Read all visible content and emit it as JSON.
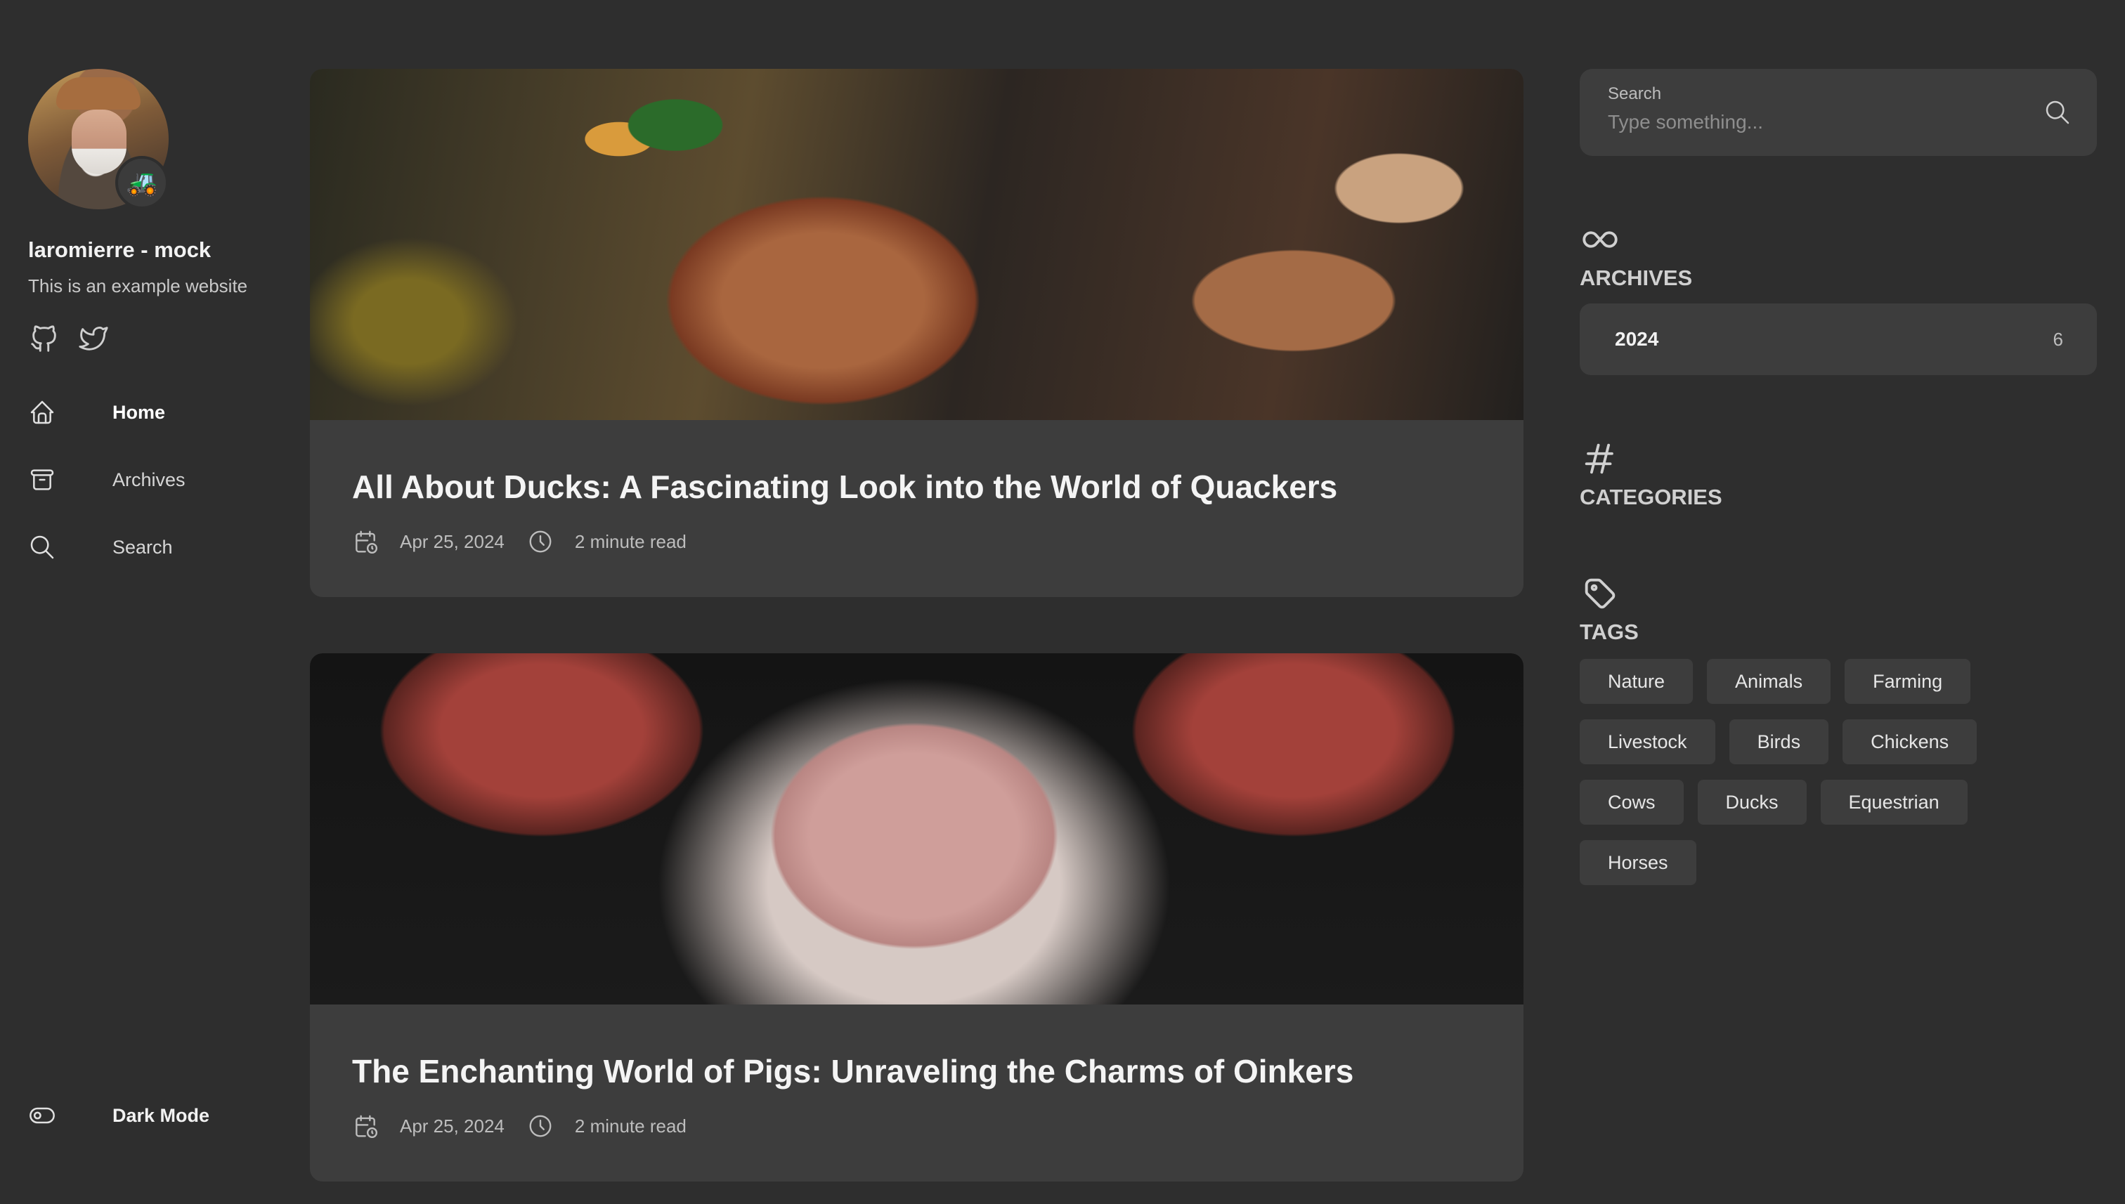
{
  "site": {
    "title": "laromierre - mock",
    "description": "This is an example website",
    "avatar_badge": "🚜"
  },
  "social": [
    {
      "icon": "github-icon"
    },
    {
      "icon": "twitter-icon"
    }
  ],
  "nav": {
    "items": [
      {
        "label": "Home",
        "icon": "home-icon",
        "active": true
      },
      {
        "label": "Archives",
        "icon": "archive-icon",
        "active": false
      },
      {
        "label": "Search",
        "icon": "search-icon",
        "active": false
      }
    ],
    "dark_mode_label": "Dark Mode"
  },
  "posts": [
    {
      "title": "All About Ducks: A Fascinating Look into the World of Quackers",
      "date": "Apr 25, 2024",
      "read_time": "2 minute read",
      "image": "duck"
    },
    {
      "title": "The Enchanting World of Pigs: Unraveling the Charms of Oinkers",
      "date": "Apr 25, 2024",
      "read_time": "2 minute read",
      "image": "pig"
    }
  ],
  "search": {
    "label": "Search",
    "placeholder": "Type something..."
  },
  "archives": {
    "title": "ARCHIVES",
    "icon": "infinity-icon",
    "years": [
      {
        "year": "2024",
        "count": "6"
      }
    ]
  },
  "categories": {
    "title": "CATEGORIES",
    "icon": "hash-icon"
  },
  "tags": {
    "title": "TAGS",
    "icon": "tag-icon",
    "items": [
      "Nature",
      "Animals",
      "Farming",
      "Livestock",
      "Birds",
      "Chickens",
      "Cows",
      "Ducks",
      "Equestrian",
      "Horses"
    ]
  },
  "colors": {
    "background": "#2e2e2e",
    "card": "#3d3d3d",
    "text": "#e8e8e8",
    "muted": "#bdbdbd"
  }
}
